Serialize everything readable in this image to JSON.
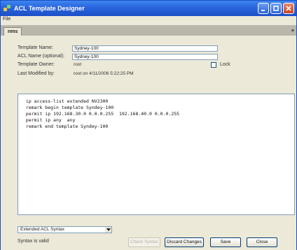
{
  "window": {
    "title": "ACL Template Designer"
  },
  "menubar": {
    "items": [
      "File"
    ]
  },
  "tabs": [
    {
      "label": "nms"
    }
  ],
  "form": {
    "template_name_label": "Template Name:",
    "template_name_value": "Sydney-100",
    "acl_name_label": "ACL Name (optional):",
    "acl_name_value": "Sydney-100",
    "template_owner_label": "Template Owner:",
    "template_owner_value": "root",
    "lock_label": "Lock",
    "last_modified_label": "Last Modified by:",
    "last_modified_value": "root on 4/11/2006 5:22:25 PM"
  },
  "editor": {
    "lines": [
      " ip access-list extended NV2300",
      " remark begin template Syndey-100",
      " permit ip 192.168.30.0 0.0.0.255  192.168.40.0 0.0.0.255",
      " permit ip any  any",
      " remark end template Syndey-100"
    ]
  },
  "footer": {
    "syntax_select": "Extended ACL Syntax",
    "status": "Syntax is valid",
    "buttons": {
      "check_syntax": "Check Syntax",
      "discard_changes": "Discard Changes",
      "save": "Save",
      "close": "Close"
    }
  },
  "colors": {
    "titlebar": "#2a64dd",
    "accent": "#1c4fc6",
    "panel": "#ece9d8"
  }
}
